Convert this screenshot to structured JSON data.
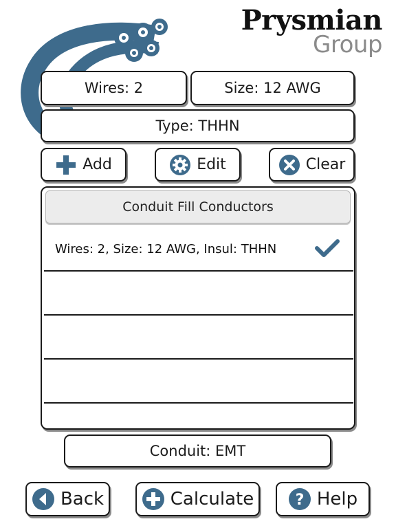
{
  "brand": {
    "name": "Prysmian",
    "subname": "Group"
  },
  "fields": {
    "wires": "Wires: 2",
    "size": "Size: 12 AWG",
    "type": "Type: THHN",
    "conduit": "Conduit: EMT"
  },
  "actions": {
    "add": "Add",
    "edit": "Edit",
    "clear": "Clear"
  },
  "list": {
    "header": "Conduit Fill Conductors",
    "rows": [
      {
        "text": "Wires: 2, Size: 12 AWG, Insul: THHN",
        "checked": true
      },
      {
        "text": "",
        "checked": false
      },
      {
        "text": "",
        "checked": false
      },
      {
        "text": "",
        "checked": false
      },
      {
        "text": "",
        "checked": false
      }
    ]
  },
  "nav": {
    "back": "Back",
    "calculate": "Calculate",
    "help": "Help"
  },
  "colors": {
    "accent": "#3e6b8c",
    "border": "#1a1a1a",
    "shadow": "#8a8a8a",
    "logo_grey": "#8b8b8b"
  },
  "icons": {
    "add": "plus-icon",
    "edit": "gear-icon",
    "clear": "close-circle-icon",
    "back": "back-arrow-icon",
    "calculate": "plus-circle-icon",
    "help": "question-icon",
    "row_status": "checkmark-icon"
  }
}
